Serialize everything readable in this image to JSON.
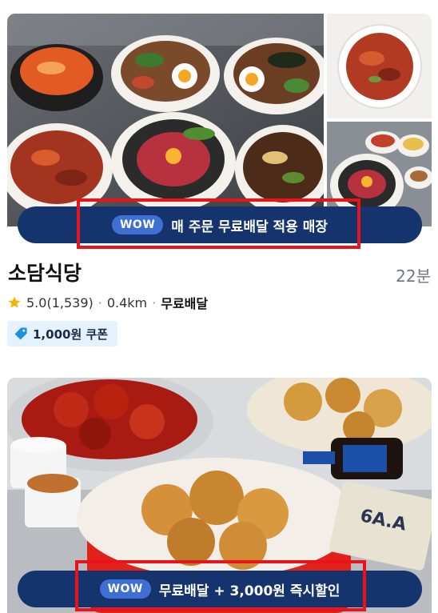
{
  "store1": {
    "images": {
      "main_alt": "korean-food-spread-photo",
      "side_top_alt": "spicy-pork-bowl-photo",
      "side_bottom_alt": "bibimbap-set-photo"
    },
    "banner": {
      "wow_label": "WOW",
      "text": "매 주문 무료배달 적용 매장"
    },
    "name": "소담식당",
    "delivery_time": "22분",
    "rating": "5.0(1,539)",
    "distance": "0.4km",
    "delivery_fee_label": "무료배달",
    "coupon": "1,000원 쿠폰"
  },
  "store2": {
    "images": {
      "main_alt": "fried-chicken-photo"
    },
    "banner": {
      "wow_label": "WOW",
      "text": "무료배달 + 3,000원 즉시할인"
    }
  },
  "colors": {
    "banner_bg": "#15346e",
    "wow_pill": "#3f6fd3",
    "highlight": "#e8131b",
    "star": "#f5b400",
    "coupon_bg": "#e3f2fc",
    "coupon_icon": "#1f8fe0"
  },
  "icons": {
    "rating": "star-icon",
    "coupon": "tag-icon"
  }
}
